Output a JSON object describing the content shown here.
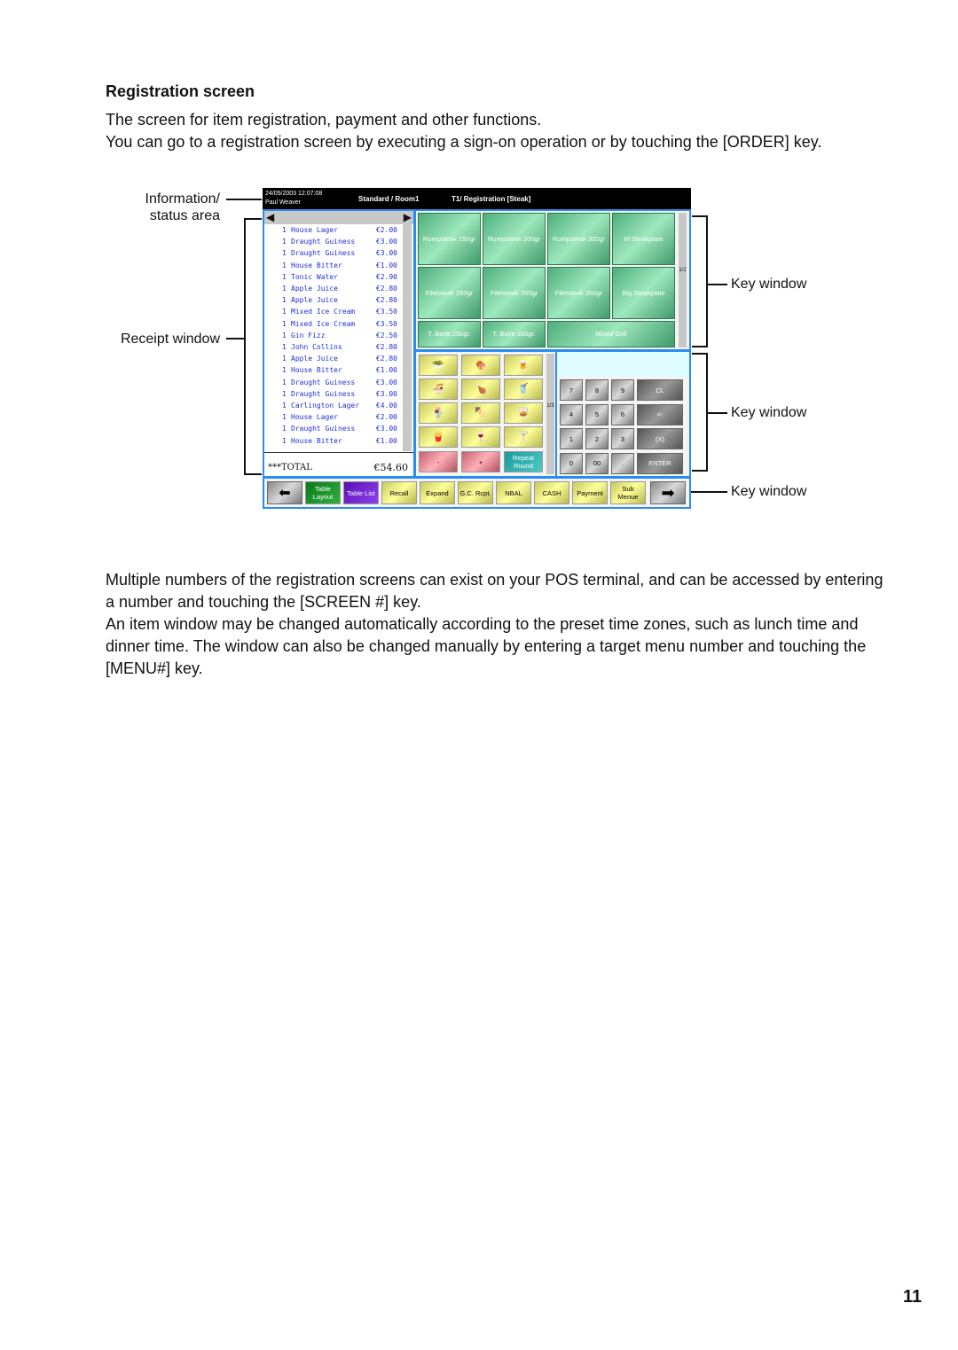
{
  "heading": "Registration screen",
  "intro": [
    "The screen for item registration, payment and other functions.",
    "You can go to a registration screen by executing a sign-on operation or by touching the [ORDER] key."
  ],
  "callouts": {
    "info_line1": "Information/",
    "info_line2": "status area",
    "receipt": "Receipt window",
    "key1": "Key window",
    "key2": "Key window",
    "key3": "Key window"
  },
  "screen": {
    "datetime": "24/05/2003 12:07:08",
    "operator": "Paul Weaver",
    "mode": "Standard / Room1",
    "title": "T1/ Registration [Steak]",
    "receipt": [
      {
        "qty": "1",
        "item": "House Lager",
        "price": "€2.00"
      },
      {
        "qty": "1",
        "item": "Draught Guiness",
        "price": "€3.00"
      },
      {
        "qty": "1",
        "item": "Draught Guiness",
        "price": "€3.00"
      },
      {
        "qty": "1",
        "item": "House Bitter",
        "price": "€1.00"
      },
      {
        "qty": "1",
        "item": "Tonic Water",
        "price": "€2.90"
      },
      {
        "qty": "1",
        "item": "Apple Juice",
        "price": "€2.80"
      },
      {
        "qty": "1",
        "item": "Apple Juice",
        "price": "€2.80"
      },
      {
        "qty": "1",
        "item": "Mixed Ice Cream",
        "price": "€3.50"
      },
      {
        "qty": "1",
        "item": "Mixed Ice Cream",
        "price": "€3.50"
      },
      {
        "qty": "1",
        "item": "Gin Fizz",
        "price": "€2.50"
      },
      {
        "qty": "1",
        "item": "John Collins",
        "price": "€2.80"
      },
      {
        "qty": "1",
        "item": "Apple Juice",
        "price": "€2.80"
      },
      {
        "qty": "1",
        "item": "House Bitter",
        "price": "€1.00"
      },
      {
        "qty": "1",
        "item": "Draught Guiness",
        "price": "€3.00"
      },
      {
        "qty": "1",
        "item": "Draught Guiness",
        "price": "€3.00"
      },
      {
        "qty": "1",
        "item": "Carlington Lager",
        "price": "€4.00"
      },
      {
        "qty": "1",
        "item": "House Lager",
        "price": "€2.00"
      },
      {
        "qty": "1",
        "item": "Draught Guiness",
        "price": "€3.00"
      },
      {
        "qty": "1",
        "item": "House Bitter",
        "price": "€1.00"
      }
    ],
    "total_label": "***TOTAL",
    "total": "€54.60",
    "steak_keys": [
      "Rumpsteak 150gr",
      "Rumpsteak 200gr",
      "Rumpsteak 300gr",
      "M.Steakplate",
      "Filetsteak 250gr",
      "Filetsteak 250gr",
      "Filetsteak 350gr",
      "Big Steakplate",
      "T. Bone 250gr.",
      "T. Bone 350gr.",
      "Mixed Grill"
    ],
    "steak_page": "1/2",
    "picture_keys": [
      "salad-icon",
      "steak-plate-icon",
      "beer-icon",
      "soup-icon",
      "chicken-icon",
      "drinks-icon",
      "ice-cream-icon",
      "grill-icon",
      "whisky-icon",
      "fries-icon",
      "wine-icon",
      "cocktail-icon"
    ],
    "picture_page": "1/3",
    "minus": "-",
    "plus": "+",
    "repeat": "Repeat Round",
    "numpad": [
      "7",
      "8",
      "9",
      "CL",
      "4",
      "5",
      "6",
      "<-",
      "1",
      "2",
      "3",
      "(X)",
      "0",
      "00",
      ".",
      "ENTER"
    ],
    "bottom": [
      "Table Layout",
      "Table List",
      "Recall",
      "Expand",
      "G.C. Rcpt.",
      "NBAL",
      "CASH",
      "Payment",
      "Sub Menue"
    ]
  },
  "body": [
    "Multiple numbers of the registration screens can exist on your POS terminal, and can be accessed by entering a number and touching the [SCREEN #] key.",
    "An item window may be changed automatically according to the preset time zones, such as lunch time and dinner time.  The window can also be changed manually by entering a target menu number and touching the [MENU#] key."
  ],
  "page_number": "11"
}
